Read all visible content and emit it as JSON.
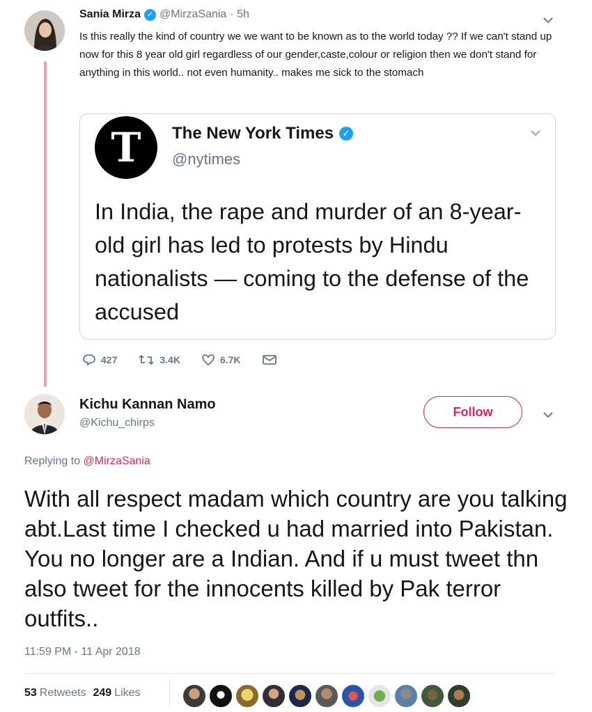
{
  "top_tweet": {
    "name": "Sania Mirza",
    "handle": "@MirzaSania",
    "time": "· 5h",
    "text": "Is this really the kind of country we we want to be known as to the world today ?? If we can't stand up now for this 8 year old girl regardless of our gender,caste,colour or religion then we don't stand for anything in this world.. not even humanity.. makes me sick to the stomach",
    "quoted": {
      "logo_glyph": "T",
      "name": "The New York Times",
      "handle": "@nytimes",
      "text": "In India, the rape and murder of an 8-year-old girl has led to protests by Hindu nationalists — coming to the defense of the accused"
    },
    "actions": {
      "replies": "427",
      "retweets": "3.4K",
      "likes": "6.7K"
    }
  },
  "reply_tweet": {
    "name": "Kichu Kannan Namo",
    "handle": "@Kichu_chirps",
    "follow_label": "Follow",
    "replying_prefix": "Replying to",
    "replying_mention": "@MirzaSania",
    "text": "With all respect madam which country are you talking abt.Last time I checked u had married into Pakistan. You no longer are a Indian. And if u must tweet thn also tweet for the innocents killed by Pak terror outfits..",
    "timestamp": "11:59 PM - 11 Apr 2018",
    "retweets_count": "53",
    "retweets_label": "Retweets",
    "likes_count": "249",
    "likes_label": "Likes"
  },
  "icons": {
    "verified": "verified-check-icon",
    "chevron": "chevron-down-icon",
    "reply": "reply-icon",
    "retweet": "retweet-icon",
    "like": "heart-icon",
    "message": "envelope-icon"
  },
  "colors": {
    "accent_red": "#e0245e",
    "verified_blue": "#1da1f2",
    "thread_line": "#f0a0a6",
    "muted": "#657786"
  }
}
